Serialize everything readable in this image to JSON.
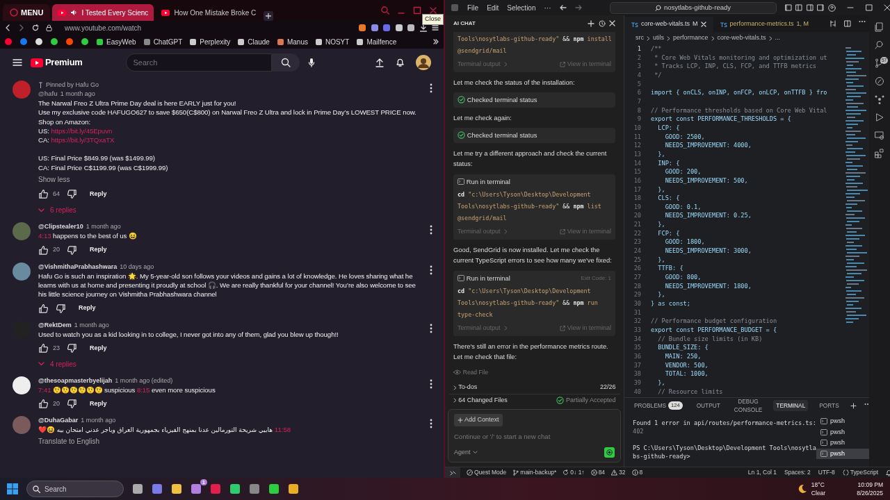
{
  "browser": {
    "menu_label": "MENU",
    "tabs": [
      {
        "title": "I Tested Every Scienc",
        "selected": true
      },
      {
        "title": "How One Mistake Broke C",
        "selected": false
      }
    ],
    "tooltip": "Close",
    "address": "www.youtube.com/watch",
    "bookmarks": [
      "EasyWeb",
      "ChatGPT",
      "Perplexity",
      "Claude",
      "Manus",
      "NOSYT",
      "Mailfence"
    ]
  },
  "youtube": {
    "logo": "Premium",
    "search_placeholder": "Search",
    "comments": [
      {
        "pinned_by": "Pinned by Hafu Go",
        "author": "@hafu",
        "time": "1 month ago",
        "body": [
          [
            [
              {
                "text": "The Narwal Freo Z Ultra Prime Day deal is here EARLY just for you!",
                "kind": "text"
              }
            ],
            [
              {
                "text": "Use my exclusive code HAFUGO627 to save $650(C$800) on Narwal Freo Z Ultra and lock in Prime Day’s LOWEST PRICE now.",
                "kind": "text"
              }
            ],
            [
              {
                "text": "Shop on Amazon:",
                "kind": "text"
              }
            ],
            [
              {
                "text": "US: ",
                "kind": "text"
              },
              {
                "text": "https://bit.ly/45Epuvn",
                "kind": "link"
              }
            ],
            [
              {
                "text": "CA: ",
                "kind": "text"
              },
              {
                "text": "https://bit.ly/3TQxaTX",
                "kind": "link"
              }
            ]
          ],
          [
            [
              {
                "text": "US: Final Price $849.99 (was $1499.99)",
                "kind": "text"
              }
            ],
            [
              {
                "text": "CA: Final Price C$1199.99 (was C$1999.99)",
                "kind": "text"
              }
            ]
          ]
        ],
        "show_less": "Show less",
        "likes": "64",
        "reply": "Reply",
        "replies": "6 replies"
      },
      {
        "author": "@Clipstealer10",
        "time": "1 month ago",
        "body": [
          [
            [
              {
                "text": "4:13",
                "kind": "link"
              },
              {
                "text": " happens to the best of us 😆",
                "kind": "text"
              }
            ]
          ]
        ],
        "likes": "20",
        "reply": "Reply"
      },
      {
        "author": "@VishmithaPrabhashwara",
        "time": "10 days ago",
        "body": [
          [
            [
              {
                "text": "Hafu Go is such an inspiration 🌟. My 5-year-old son follows your videos and gains a lot of knowledge. He loves sharing what he learns with us at home and presenting it proudly at school 🎧. We are really thankful for your channel! You’re also welcome to see his little science journey on Vishmitha Prabhashwara channel",
                "kind": "text"
              }
            ]
          ]
        ],
        "reply": "Reply"
      },
      {
        "author": "@RektDem",
        "time": "1 month ago",
        "body": [
          [
            [
              {
                "text": "Used to watch you as a kid looking in to college, I never got into any of them, glad you blew up though!!",
                "kind": "text"
              }
            ]
          ]
        ],
        "likes": "23",
        "reply": "Reply",
        "replies": "4 replies"
      },
      {
        "author": "@thesoapmasterbyelijah",
        "time": "1 month ago (edited)",
        "body": [
          [
            [
              {
                "text": "7:41",
                "kind": "link"
              },
              {
                "text": " 🤨🤨🤨🤨🤨🤨 suspicious ",
                "kind": "text"
              },
              {
                "text": "8:15",
                "kind": "link"
              },
              {
                "text": " even more suspicious",
                "kind": "text"
              }
            ]
          ]
        ],
        "likes": "20",
        "reply": "Reply"
      },
      {
        "author": "@DuhaGabar",
        "time": "1 month ago",
        "body": [
          [
            [
              {
                "text": "❤️😆 ",
                "kind": "text"
              },
              {
                "text": "هابيي شريحة التورمالين عدنا بمنهج الفيزياء بجمهورية العراق وباجر عدني امتحان بيه",
                "kind": "rtl"
              },
              {
                "text": " 11:58",
                "kind": "link"
              }
            ]
          ]
        ],
        "translate": "Translate to English"
      }
    ]
  },
  "vscode": {
    "menu": [
      "File",
      "Edit",
      "Selection",
      "···"
    ],
    "search": "nosytlabs-github-ready",
    "activity_badge": "57"
  },
  "chat": {
    "title": "AI CHAT",
    "messages": [
      {
        "kind": "terminal",
        "code": [
          [
            {
              "text": "Tools\\nosytlabs-github-ready\"",
              "kind": "arg"
            },
            {
              "text": " && ",
              "kind": "plain"
            },
            {
              "text": "npm",
              "kind": "cmd"
            },
            {
              "text": " install",
              "kind": "arg"
            }
          ],
          [
            {
              "text": "@sendgrid/mail",
              "kind": "arg"
            }
          ]
        ],
        "output": "Terminal output",
        "view": "View in terminal"
      },
      {
        "kind": "text",
        "text": "Let me check the status of the installation:"
      },
      {
        "kind": "status",
        "text": "Checked terminal status"
      },
      {
        "kind": "text",
        "text": "Let me check again:"
      },
      {
        "kind": "status",
        "text": "Checked terminal status"
      },
      {
        "kind": "text",
        "text": "Let me try a different approach and check the current status:"
      },
      {
        "kind": "terminal",
        "title": "Run in terminal",
        "code": [
          [
            {
              "text": "cd",
              "kind": "cmd"
            },
            {
              "text": " \"c:\\Users\\Tyson\\Desktop\\Development",
              "kind": "arg"
            }
          ],
          [
            {
              "text": "Tools\\nosytlabs-github-ready\"",
              "kind": "arg"
            },
            {
              "text": " && ",
              "kind": "plain"
            },
            {
              "text": "npm",
              "kind": "cmd"
            },
            {
              "text": " list",
              "kind": "arg"
            }
          ],
          [
            {
              "text": "@sendgrid/mail",
              "kind": "arg"
            }
          ]
        ],
        "output": "Terminal output",
        "view": "View in terminal"
      },
      {
        "kind": "text",
        "text": "Good, SendGrid is now installed. Let me check the current TypeScript errors to see how many we've fixed:"
      },
      {
        "kind": "terminal",
        "title": "Run in terminal",
        "exit": "Exit Code: 1",
        "code": [
          [
            {
              "text": "cd",
              "kind": "cmd"
            },
            {
              "text": " \"c:\\Users\\Tyson\\Desktop\\Development",
              "kind": "arg"
            }
          ],
          [
            {
              "text": "Tools\\nosytlabs-github-ready\"",
              "kind": "arg"
            },
            {
              "text": " && ",
              "kind": "plain"
            },
            {
              "text": "npm",
              "kind": "cmd"
            },
            {
              "text": " run",
              "kind": "arg"
            }
          ],
          [
            {
              "text": "type-check",
              "kind": "arg"
            }
          ]
        ],
        "output": "Terminal output",
        "view": "View in terminal"
      },
      {
        "kind": "text",
        "text": "There's still an error in the performance metrics route. Let me check that file:"
      },
      {
        "kind": "read",
        "text": "Read File"
      }
    ],
    "todos": {
      "label": "To-dos",
      "count": "22/26"
    },
    "changes": {
      "label": "64 Changed Files",
      "status": "Partially Accepted"
    },
    "add_context": "Add Context",
    "placeholder": "Continue or '/' to start a new chat",
    "mode": "Agent"
  },
  "editor": {
    "tabs": [
      {
        "name": "core-web-vitals.ts",
        "badge": "M",
        "selected": true
      },
      {
        "name": "performance-metrics.ts",
        "badge": "1, M",
        "selected": false
      }
    ],
    "breadcrumb": [
      "src",
      "utils",
      "performance",
      "core-web-vitals.ts",
      "..."
    ],
    "lines": [
      {
        "n": "1",
        "text": "/**",
        "kind": "comment"
      },
      {
        "n": "2",
        "text": " * Core Web Vitals monitoring and optimization ut",
        "kind": "comment"
      },
      {
        "n": "3",
        "text": " * Tracks LCP, INP, CLS, FCP, and TTFB metrics",
        "kind": "comment"
      },
      {
        "n": "4",
        "text": " */",
        "kind": "comment"
      },
      {
        "n": "5",
        "kind": "code"
      },
      {
        "n": "6",
        "text": "import { onCLS, onINP, onFCP, onLCP, onTTFB } fro",
        "kind": "code"
      },
      {
        "n": "7",
        "kind": "code"
      },
      {
        "n": "8",
        "text": "// Performance thresholds based on Core Web Vital",
        "kind": "comment"
      },
      {
        "n": "9",
        "text": "export const PERFORMANCE_THRESHOLDS = {",
        "kind": "code"
      },
      {
        "n": "10",
        "text": "  LCP: {",
        "kind": "code"
      },
      {
        "n": "11",
        "text": "    GOOD: 2500,",
        "kind": "code"
      },
      {
        "n": "12",
        "text": "    NEEDS_IMPROVEMENT: 4000,",
        "kind": "code"
      },
      {
        "n": "13",
        "text": "  },",
        "kind": "code"
      },
      {
        "n": "14",
        "text": "  INP: {",
        "kind": "code"
      },
      {
        "n": "15",
        "text": "    GOOD: 200,",
        "kind": "code"
      },
      {
        "n": "16",
        "text": "    NEEDS_IMPROVEMENT: 500,",
        "kind": "code"
      },
      {
        "n": "17",
        "text": "  },",
        "kind": "code"
      },
      {
        "n": "18",
        "text": "  CLS: {",
        "kind": "code"
      },
      {
        "n": "19",
        "text": "    GOOD: 0.1,",
        "kind": "code"
      },
      {
        "n": "20",
        "text": "    NEEDS_IMPROVEMENT: 0.25,",
        "kind": "code"
      },
      {
        "n": "21",
        "text": "  },",
        "kind": "code"
      },
      {
        "n": "22",
        "text": "  FCP: {",
        "kind": "code"
      },
      {
        "n": "23",
        "text": "    GOOD: 1800,",
        "kind": "code"
      },
      {
        "n": "24",
        "text": "    NEEDS_IMPROVEMENT: 3000,",
        "kind": "code"
      },
      {
        "n": "25",
        "text": "  },",
        "kind": "code"
      },
      {
        "n": "26",
        "text": "  TTFB: {",
        "kind": "code"
      },
      {
        "n": "27",
        "text": "    GOOD: 800,",
        "kind": "code"
      },
      {
        "n": "28",
        "text": "    NEEDS_IMPROVEMENT: 1800,",
        "kind": "code"
      },
      {
        "n": "29",
        "text": "  },",
        "kind": "code"
      },
      {
        "n": "30",
        "text": "} as const;",
        "kind": "code"
      },
      {
        "n": "31",
        "kind": "code"
      },
      {
        "n": "32",
        "text": "// Performance budget configuration",
        "kind": "comment"
      },
      {
        "n": "33",
        "text": "export const PERFORMANCE_BUDGET = {",
        "kind": "code"
      },
      {
        "n": "34",
        "text": "  // Bundle size limits (in KB)",
        "kind": "comment"
      },
      {
        "n": "35",
        "text": "  BUNDLE_SIZE: {",
        "kind": "code"
      },
      {
        "n": "36",
        "text": "    MAIN: 250,",
        "kind": "code"
      },
      {
        "n": "37",
        "text": "    VENDOR: 500,",
        "kind": "code"
      },
      {
        "n": "38",
        "text": "    TOTAL: 1000,",
        "kind": "code"
      },
      {
        "n": "39",
        "text": "  },",
        "kind": "code"
      },
      {
        "n": "40",
        "text": "  // Resource limits",
        "kind": "comment"
      }
    ]
  },
  "panel": {
    "tabs": [
      {
        "label": "PROBLEMS",
        "count": "124",
        "selected": false
      },
      {
        "label": "OUTPUT",
        "selected": false
      },
      {
        "label": "DEBUG CONSOLE",
        "selected": false
      },
      {
        "label": "TERMINAL",
        "selected": true
      },
      {
        "label": "PORTS",
        "selected": false
      }
    ],
    "terminal": [
      {
        "text": "Found 1 error in api/routes/performance-metrics.ts:",
        "kind": "output"
      },
      {
        "text": "402",
        "kind": "dim"
      },
      {
        "text": "PS C:\\Users\\Tyson\\Desktop\\Development Tools\\nosytla",
        "kind": "prompt"
      },
      {
        "text": "bs-github-ready>",
        "kind": "output"
      }
    ],
    "terminals": [
      {
        "label": "pwsh",
        "selected": false
      },
      {
        "label": "pwsh",
        "selected": false
      },
      {
        "label": "pwsh",
        "selected": false
      },
      {
        "label": "pwsh",
        "selected": true
      }
    ]
  },
  "status_bar": {
    "left": [
      {
        "kind": "mode",
        "text": "Quest Mode"
      },
      {
        "kind": "branch",
        "text": "main-backup*"
      },
      {
        "kind": "sync",
        "text": "0↓ 1↑"
      },
      {
        "kind": "errors",
        "text": "84"
      },
      {
        "kind": "warnings",
        "text": "32"
      },
      {
        "kind": "infos",
        "text": "8"
      }
    ],
    "right": [
      {
        "kind": "position",
        "text": "Ln 1, Col 1"
      },
      {
        "kind": "indent",
        "text": "Spaces: 2"
      },
      {
        "kind": "encoding",
        "text": "UTF-8"
      },
      {
        "kind": "language",
        "text": "TypeScript"
      }
    ]
  },
  "taskbar": {
    "search_placeholder": "Search",
    "badge": "1",
    "temperature": "18°C",
    "weather": "Clear",
    "time": "10:09 PM",
    "date": "8/26/2025"
  }
}
